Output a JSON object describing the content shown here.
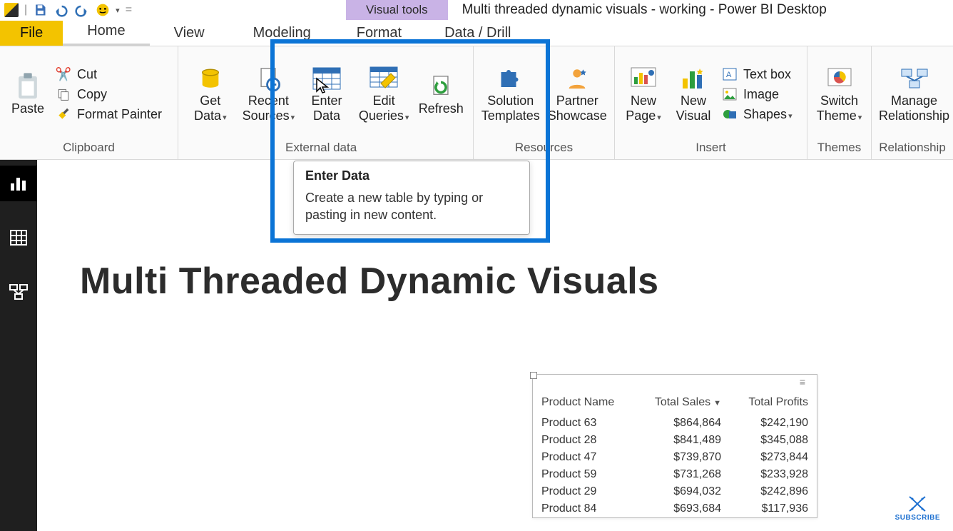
{
  "window_title": "Multi threaded dynamic visuals - working - Power BI Desktop",
  "contextual_tab": "Visual tools",
  "tabs": {
    "file": "File",
    "home": "Home",
    "view": "View",
    "modeling": "Modeling",
    "format": "Format",
    "datadrill": "Data / Drill"
  },
  "ribbon": {
    "clipboard": {
      "label": "Clipboard",
      "paste": "Paste",
      "cut": "Cut",
      "copy": "Copy",
      "format_painter": "Format Painter"
    },
    "external": {
      "label": "External data",
      "get_data": "Get\nData",
      "recent_sources": "Recent\nSources",
      "enter_data": "Enter\nData",
      "edit_queries": "Edit\nQueries",
      "refresh": "Refresh"
    },
    "resources": {
      "label": "Resources",
      "solution_templates": "Solution\nTemplates",
      "partner_showcase": "Partner\nShowcase"
    },
    "insert": {
      "label": "Insert",
      "new_page": "New\nPage",
      "new_visual": "New\nVisual",
      "text_box": "Text box",
      "image": "Image",
      "shapes": "Shapes"
    },
    "themes": {
      "label": "Themes",
      "switch_theme": "Switch\nTheme"
    },
    "relationships": {
      "label": "Relationship",
      "manage": "Manage\nRelationship"
    }
  },
  "tooltip": {
    "title": "Enter Data",
    "body": "Create a new table by typing or pasting in new content."
  },
  "canvas": {
    "title": "Multi Threaded Dynamic Visuals"
  },
  "table_visual": {
    "columns": [
      "Product Name",
      "Total Sales",
      "Total Profits"
    ],
    "sort_col": 1,
    "rows": [
      [
        "Product 63",
        "$864,864",
        "$242,190"
      ],
      [
        "Product 28",
        "$841,489",
        "$345,088"
      ],
      [
        "Product 47",
        "$739,870",
        "$273,844"
      ],
      [
        "Product 59",
        "$731,268",
        "$233,928"
      ],
      [
        "Product 29",
        "$694,032",
        "$242,896"
      ],
      [
        "Product 84",
        "$693,684",
        "$117,936"
      ]
    ]
  },
  "subscribe": "SUBSCRIBE"
}
